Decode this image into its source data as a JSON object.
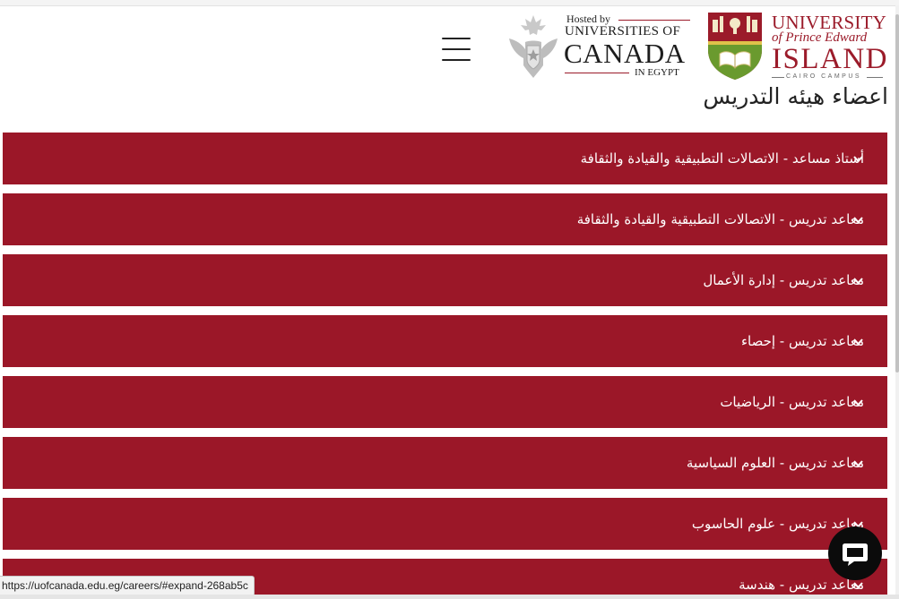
{
  "browser": {
    "status_url": "https://uofcanada.edu.eg/careers/#expand-268ab5c"
  },
  "header": {
    "menu_icon": "hamburger-menu-icon",
    "canada_logo": {
      "hosted_by": "Hosted by",
      "line1": "UNIVERSITIES OF",
      "line2": "CANADA",
      "line3": "IN EGYPT"
    },
    "upei_logo": {
      "line1": "UNIVERSITY",
      "line2": "of Prince Edward",
      "line3": "ISLAND",
      "line4": "CAIRO CAMPUS"
    }
  },
  "main": {
    "title": "اعضاء هيئه التدريس",
    "positions": [
      {
        "label": "أستاذ مساعد - الاتصالات التطبيقية والقيادة والثقافة"
      },
      {
        "label": "معاعد تدريس - الاتصالات التطبيقية والقيادة والثقافة"
      },
      {
        "label": "معاعد تدريس - إدارة الأعمال"
      },
      {
        "label": "معاعد تدريس - إحصاء"
      },
      {
        "label": "معاعد تدريس - الرياضيات"
      },
      {
        "label": "معاعد تدريس - العلوم السياسية"
      },
      {
        "label": "معاعد تدريس - علوم الحاسوب"
      },
      {
        "label": "معاعد تدريس - هندسة"
      }
    ]
  },
  "colors": {
    "accordion_bg": "#9b1728",
    "brand_red": "#9b1b2a",
    "chat_button_bg": "#0b0b0b"
  },
  "chat": {
    "icon": "chat-bubble-icon"
  }
}
